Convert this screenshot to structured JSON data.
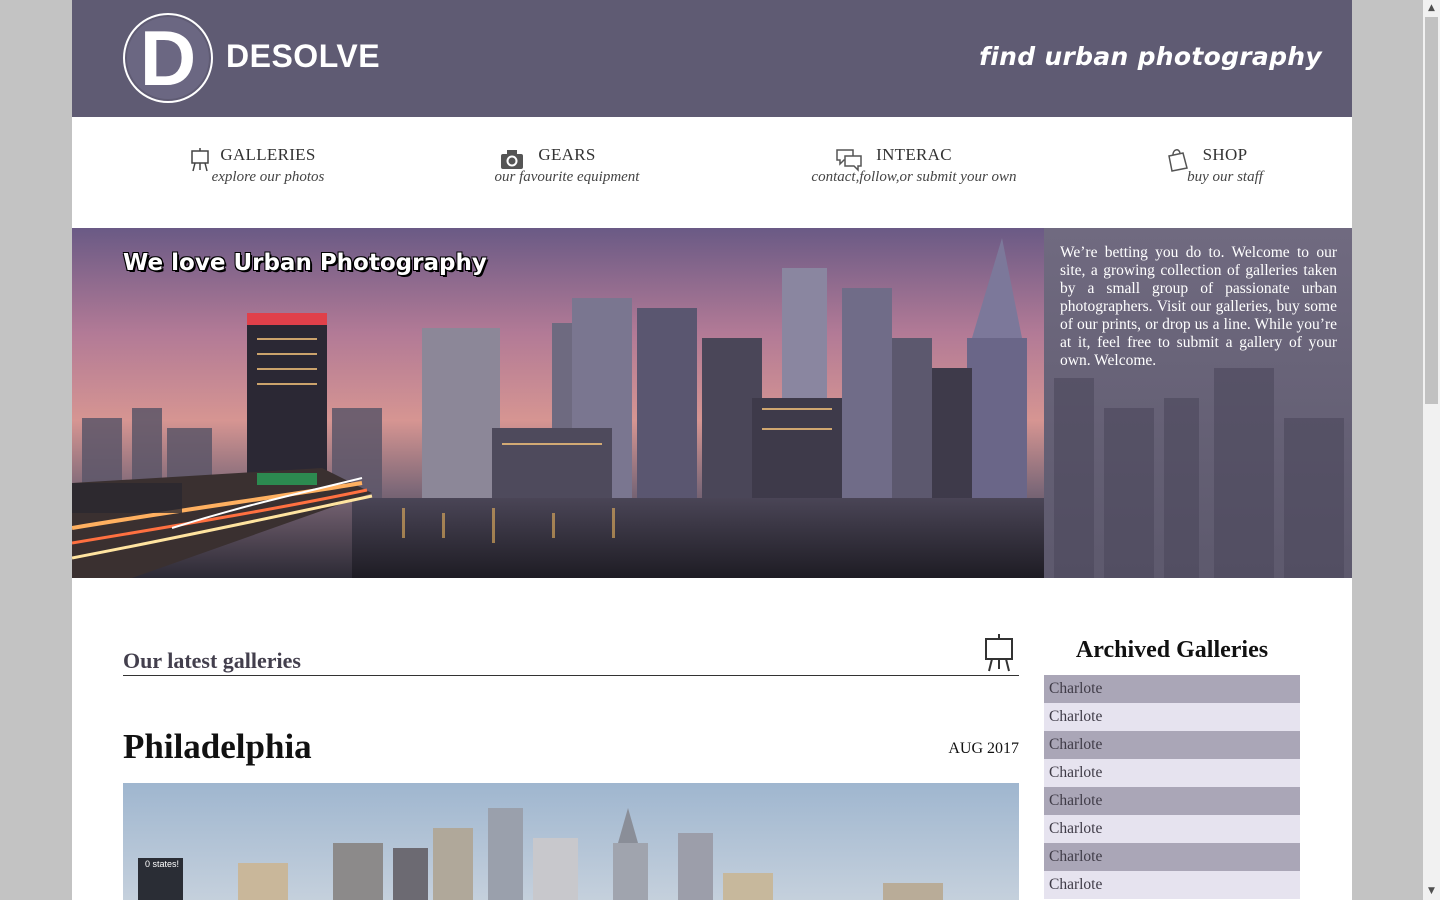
{
  "header": {
    "logo_letter": "D",
    "brand": "DESOLVE",
    "tagline": "find urban photography"
  },
  "nav": [
    {
      "title": "GALLERIES",
      "sub": "explore our photos",
      "icon": "easel-icon"
    },
    {
      "title": "GEARS",
      "sub": "our favourite equipment",
      "icon": "camera-icon"
    },
    {
      "title": "INTERAC",
      "sub": "contact,follow,or submit your own",
      "icon": "chat-bubbles-icon"
    },
    {
      "title": "SHOP",
      "sub": "buy our staff",
      "icon": "shopping-bag-icon"
    }
  ],
  "hero": {
    "title": "We love Urban Photography",
    "paragraph": "We’re betting you do to. Welcome to our site, a growing collection of galleries taken by a small group of passionate urban photographers. Visit our galleries, buy some of our prints, or drop us a line. While you’re at it, feel free to submit a gallery of your own. Welcome."
  },
  "latest": {
    "section_title": "Our latest galleries",
    "gallery_name": "Philadelphia",
    "gallery_date": "AUG 2017"
  },
  "sidebar": {
    "title": "Archived Galleries",
    "items": [
      "Charlote",
      "Charlote",
      "Charlote",
      "Charlote",
      "Charlote",
      "Charlote",
      "Charlote",
      "Charlote"
    ]
  },
  "colors": {
    "header_bg": "#5f5b73",
    "archive_dark": "#aaa6b7",
    "archive_light": "#e6e3ef"
  }
}
